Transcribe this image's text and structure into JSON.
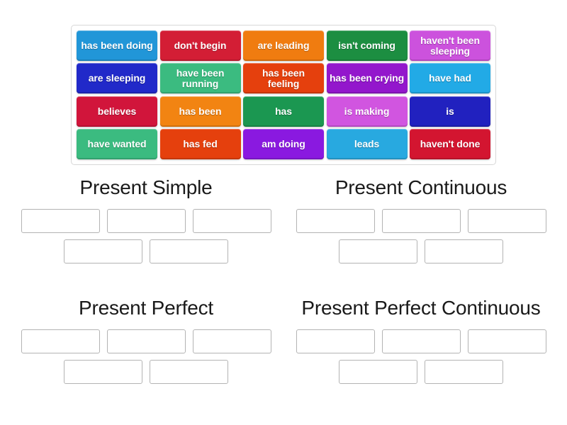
{
  "tile_bank": {
    "name": "word-tile-bank",
    "rows": [
      [
        {
          "label": "has been doing",
          "color": "#2196D8"
        },
        {
          "label": "don't begin",
          "color": "#D31E35"
        },
        {
          "label": "are leading",
          "color": "#F07C10"
        },
        {
          "label": "isn't coming",
          "color": "#1C8E41"
        },
        {
          "label": "haven't been sleeping",
          "color": "#CC52DD"
        }
      ],
      [
        {
          "label": "are sleeping",
          "color": "#2129C9"
        },
        {
          "label": "have been running",
          "color": "#3BBB80"
        },
        {
          "label": "has been feeling",
          "color": "#E5400D"
        },
        {
          "label": "has been crying",
          "color": "#9317CC"
        },
        {
          "label": "have had",
          "color": "#22AAE6"
        }
      ],
      [
        {
          "label": "believes",
          "color": "#D1153B"
        },
        {
          "label": "has been",
          "color": "#F28412"
        },
        {
          "label": "has",
          "color": "#1B9751"
        },
        {
          "label": "is making",
          "color": "#D155E0"
        },
        {
          "label": "is",
          "color": "#2121BF"
        }
      ],
      [
        {
          "label": "have wanted",
          "color": "#3BBB80"
        },
        {
          "label": "has fed",
          "color": "#E5400D"
        },
        {
          "label": "am doing",
          "color": "#8A19E0"
        },
        {
          "label": "leads",
          "color": "#28A9E0"
        },
        {
          "label": "haven't done",
          "color": "#D31530"
        }
      ]
    ]
  },
  "categories": [
    {
      "title": "Present Simple",
      "slot_rows": [
        3,
        2
      ],
      "slots": [
        "",
        "",
        "",
        "",
        ""
      ]
    },
    {
      "title": "Present Continuous",
      "slot_rows": [
        3,
        2
      ],
      "slots": [
        "",
        "",
        "",
        "",
        ""
      ]
    },
    {
      "title": "Present Perfect",
      "slot_rows": [
        3,
        2
      ],
      "slots": [
        "",
        "",
        "",
        "",
        ""
      ]
    },
    {
      "title": "Present Perfect Continuous",
      "slot_rows": [
        3,
        2
      ],
      "slots": [
        "",
        "",
        "",
        "",
        ""
      ]
    }
  ]
}
